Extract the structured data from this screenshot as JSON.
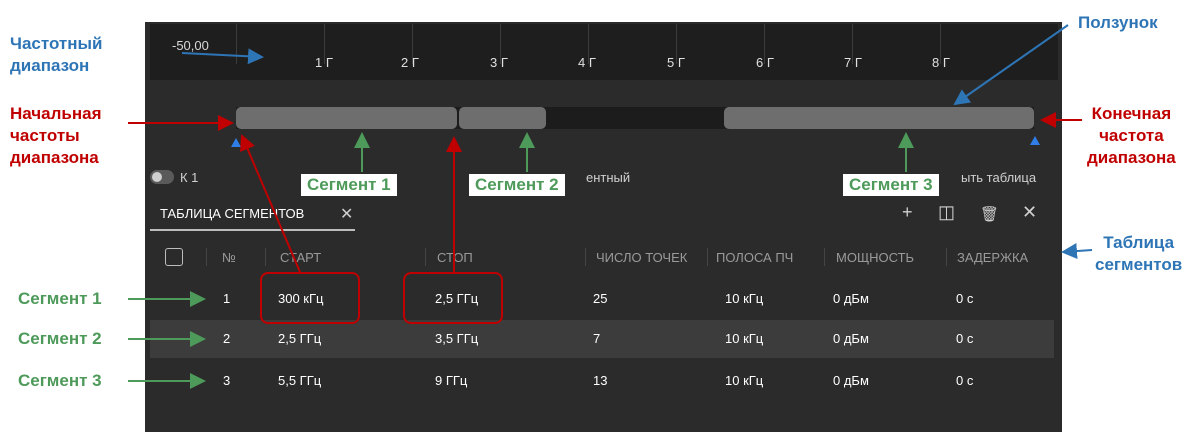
{
  "axis": {
    "y_value": "-50,00",
    "ticks": [
      "1 Г",
      "2 Г",
      "3 Г",
      "4 Г",
      "5 Г",
      "6 Г",
      "7 Г",
      "8 Г"
    ]
  },
  "channel": {
    "label": "К 1"
  },
  "partial_texts": {
    "middle": "ентный",
    "right": "ыть таблица"
  },
  "segment_labels": [
    "Сегмент 1",
    "Сегмент 2",
    "Сегмент 3"
  ],
  "table": {
    "tab_title": "ТАБЛИЦА СЕГМЕНТОВ",
    "close_glyph": "✕",
    "toolbar": {
      "add": "+",
      "split": "◫",
      "delete": "🗑",
      "close": "✕"
    },
    "columns": [
      "№",
      "СТАРТ",
      "СТОП",
      "ЧИСЛО ТОЧЕК",
      "ПОЛОСА ПЧ",
      "МОЩНОСТЬ",
      "ЗАДЕРЖКА"
    ],
    "rows": [
      [
        "1",
        "300 кГц",
        "2,5 ГГц",
        "25",
        "10 кГц",
        "0 дБм",
        "0 с"
      ],
      [
        "2",
        "2,5 ГГц",
        "3,5 ГГц",
        "7",
        "10 кГц",
        "0 дБм",
        "0 с"
      ],
      [
        "3",
        "5,5 ГГц",
        "9 ГГц",
        "13",
        "10 кГц",
        "0 дБм",
        "0 с"
      ]
    ]
  },
  "annotations": {
    "freq_range": [
      "Частотный",
      "диапазон"
    ],
    "start_freq": [
      "Начальная",
      "частоты",
      "диапазона"
    ],
    "slider": "Ползунок",
    "end_freq": [
      "Конечная",
      "частота",
      "диапазона"
    ],
    "segment_table": [
      "Таблица",
      "сегментов"
    ],
    "row_labels": [
      "Сегмент 1",
      "Сегмент 2",
      "Сегмент 3"
    ]
  },
  "colors": {
    "background": "#2b2b2b",
    "segment_bar": "#6e6e6e",
    "highlight_box": "#c00000",
    "annotation_blue": "#2e75b6",
    "annotation_red": "#c00000",
    "annotation_green": "#4e9a5a",
    "marker_blue": "#2f7ee8"
  }
}
